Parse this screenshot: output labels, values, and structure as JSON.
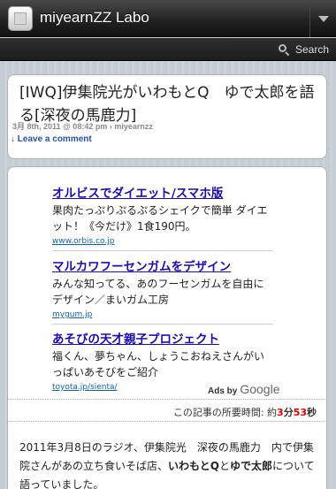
{
  "header": {
    "site_title": "miyearnZZ Labo",
    "search_label": "Search"
  },
  "post": {
    "title": "[IWQ]伊集院光がいわもとQ　ゆで太郎を語る[深夜の馬鹿力]",
    "meta": "3月 8th, 2011 @ 08:42 pm › miyearnzz",
    "comment_link": "↓ Leave a comment"
  },
  "ads": {
    "items": [
      {
        "title": "オルビスでダイエット/スマホ版",
        "desc": "果肉たっぷりぷるぷるシェイクで簡単 ダイエット！《今だけ》1食190円。",
        "url": "www.orbis.co.jp"
      },
      {
        "title": "マルカワフーセンガムをデザイン",
        "desc": "みんな知ってる、あのフーセンガムを自由にデザイン／まいガム工房",
        "url": "mygum.jp"
      },
      {
        "title": "あそびの天才親子プロジェクト",
        "desc": "福くん、夢ちゃん、しょうこおねえさんがいっぱいあそびをご紹介",
        "url": "toyota.jp/sienta/"
      }
    ],
    "ads_by": "Ads by",
    "google": "Google"
  },
  "read_time": {
    "prefix": "この記事の所要時間: 約",
    "minutes": "3",
    "minutes_unit": "分",
    "seconds": "53",
    "seconds_unit": "秒"
  },
  "body": {
    "part1": "2011年3月8日のラジオ、伊集院光　深夜の馬鹿力　内で伊集院さんがあの立ち食いそば店、",
    "bold1": "いわもとQ",
    "part2": "と",
    "bold2": "ゆで太郎",
    "part3": "について語っていました。"
  }
}
